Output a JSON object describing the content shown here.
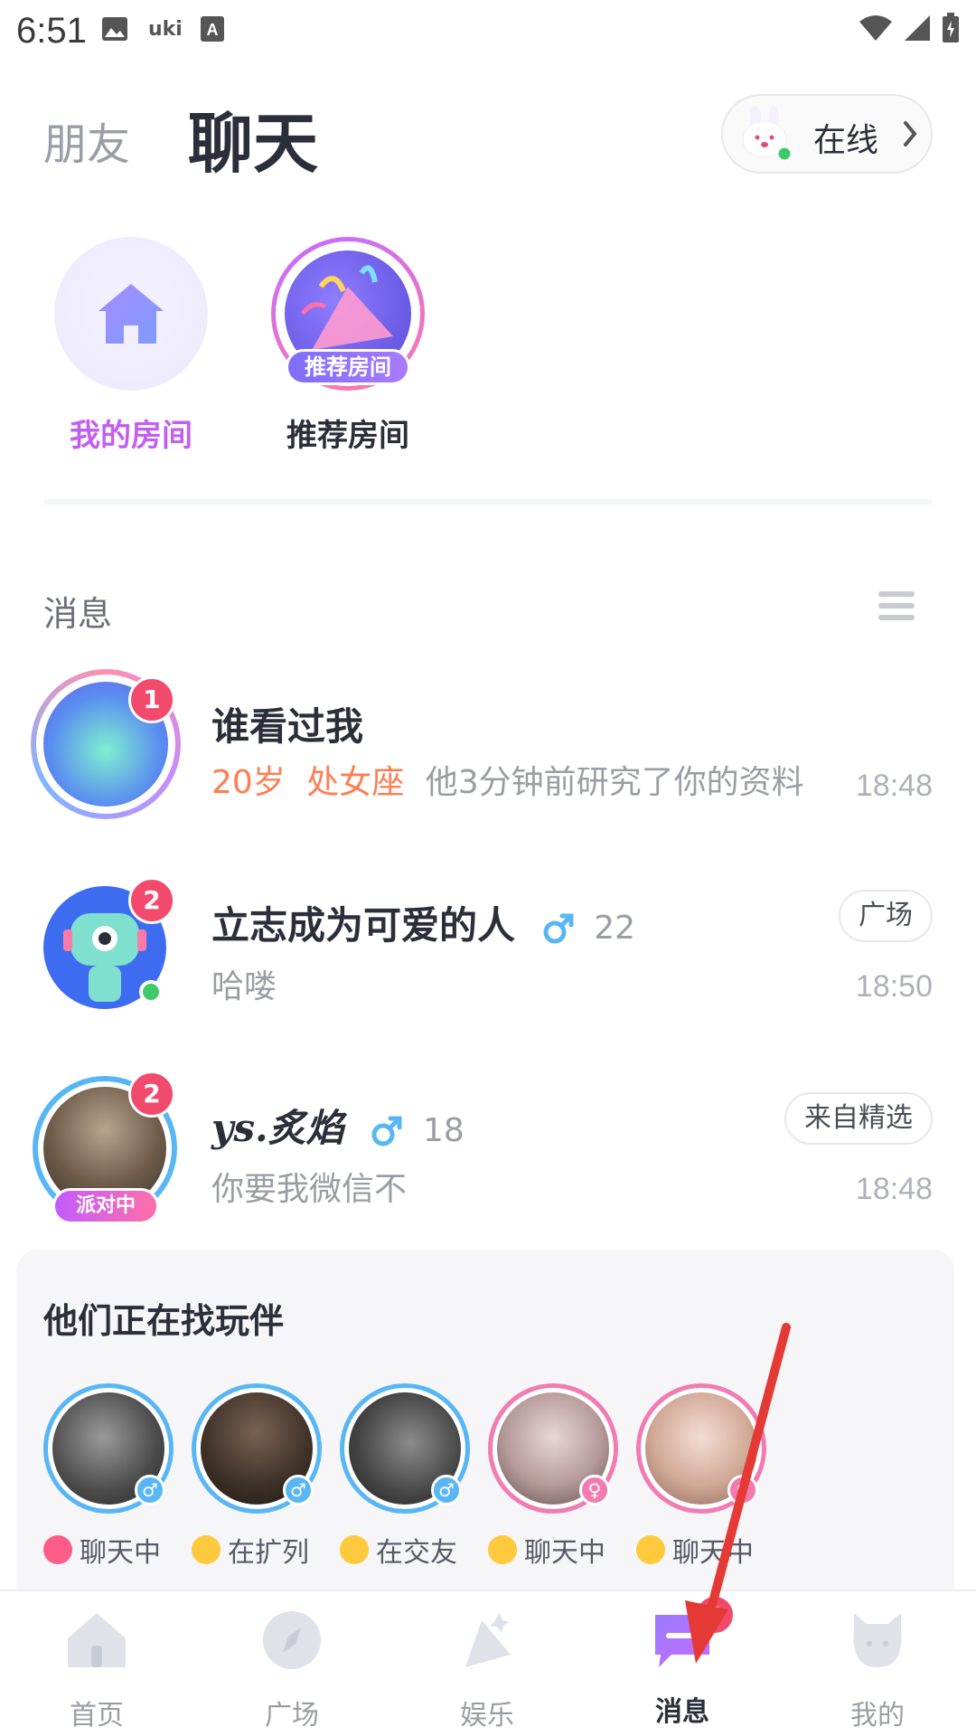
{
  "status_bar": {
    "time": "6:51",
    "uki": "uki"
  },
  "header": {
    "tab_friends": "朋友",
    "tab_chat": "聊天",
    "online_status": "在线"
  },
  "rooms": {
    "my_room": "我的房间",
    "recommended": "推荐房间",
    "recommended_badge": "推荐房间"
  },
  "messages": {
    "title": "消息",
    "rows": [
      {
        "name": "谁看过我",
        "badge": "1",
        "age_text": "20岁",
        "zodiac": "处女座",
        "preview": "他3分钟前研究了你的资料",
        "time": "18:48"
      },
      {
        "name": "立志成为可爱的人",
        "badge": "2",
        "gender": "male",
        "age": "22",
        "preview": "哈喽",
        "tag": "广场",
        "time": "18:50"
      },
      {
        "name": "ys.炙焰",
        "badge": "2",
        "gender": "male",
        "age": "18",
        "preview": "你要我微信不",
        "tag": "来自精选",
        "party": "派对中",
        "time": "18:48"
      }
    ]
  },
  "companions": {
    "title": "他们正在找玩伴",
    "items": [
      {
        "status": "聊天中",
        "gender": "male",
        "emoji": "heart"
      },
      {
        "status": "在扩列",
        "gender": "male",
        "emoji": "chick"
      },
      {
        "status": "在交友",
        "gender": "male",
        "emoji": "chick"
      },
      {
        "status": "聊天中",
        "gender": "female",
        "emoji": "chick"
      },
      {
        "status": "聊天中",
        "gender": "female",
        "emoji": "chick"
      }
    ]
  },
  "nav": {
    "home": "首页",
    "square": "广场",
    "fun": "娱乐",
    "messages": "消息",
    "messages_badge": "3",
    "mine": "我的"
  },
  "colors": {
    "accent_purple": "#c35ff0",
    "badge_red": "#f24a6d",
    "male_blue": "#58b6f5",
    "female_pink": "#f27cb0",
    "orange": "#ff7d4f",
    "annotation_arrow": "#e53935"
  }
}
